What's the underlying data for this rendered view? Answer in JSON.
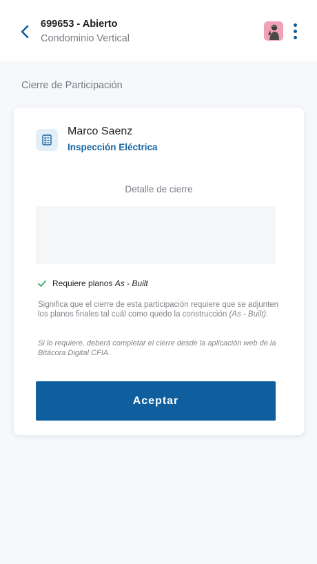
{
  "header": {
    "title": "699653 - Abierto",
    "subtitle": "Condominio Vertical",
    "back_icon": "chevron-left-icon",
    "menu_icon": "more-vertical-icon",
    "accent": "#0c5d98"
  },
  "section": {
    "title": "Cierre de Participación"
  },
  "card": {
    "person_name": "Marco Saenz",
    "person_role": "Inspección Eléctrica",
    "icon": "clipboard-checklist-icon",
    "detail_label": "Detalle de cierre",
    "detail_value": "",
    "requirement": {
      "checked": true,
      "text": "Requiere planos ",
      "emphasis": "As - Built",
      "check_color": "#3aa86b"
    },
    "description": {
      "text": "Significa que el cierre de esta participación requiere que se adjunten los planos finales tal cuál como quedo la construcción ",
      "emphasis": "(As - Built)."
    },
    "note": "Si lo requiere, deberá completar el cierre desde la aplicación web de la Bitácora Digital CFIA.",
    "accept_label": "Aceptar",
    "button_color": "#0f5f9e"
  }
}
